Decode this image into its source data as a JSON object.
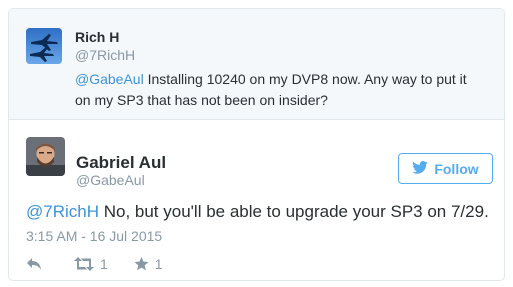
{
  "reply_to": {
    "name": "Rich H",
    "handle": "@7RichH",
    "mention": "@GabeAul",
    "text_line1": " Installing 10240 on my DVP8 now. Any way to put it",
    "text_line2": "on my SP3 that has not been on insider?"
  },
  "tweet": {
    "name": "Gabriel Aul",
    "handle": "@GabeAul",
    "follow_label": "Follow",
    "mention": "@7RichH",
    "text": " No, but you'll be able to upgrade your SP3 on 7/29.",
    "timestamp": "3:15 AM - 16 Jul 2015",
    "retweet_count": "1",
    "favorite_count": "1"
  },
  "colors": {
    "link": "#3b94d9",
    "follow": "#55acee",
    "muted": "#8899a6",
    "reply_bg": "#f5f8fa"
  },
  "icons": {
    "reply": "reply-icon",
    "retweet": "retweet-icon",
    "favorite": "star-icon",
    "follow_bird": "twitter-bird-icon"
  }
}
